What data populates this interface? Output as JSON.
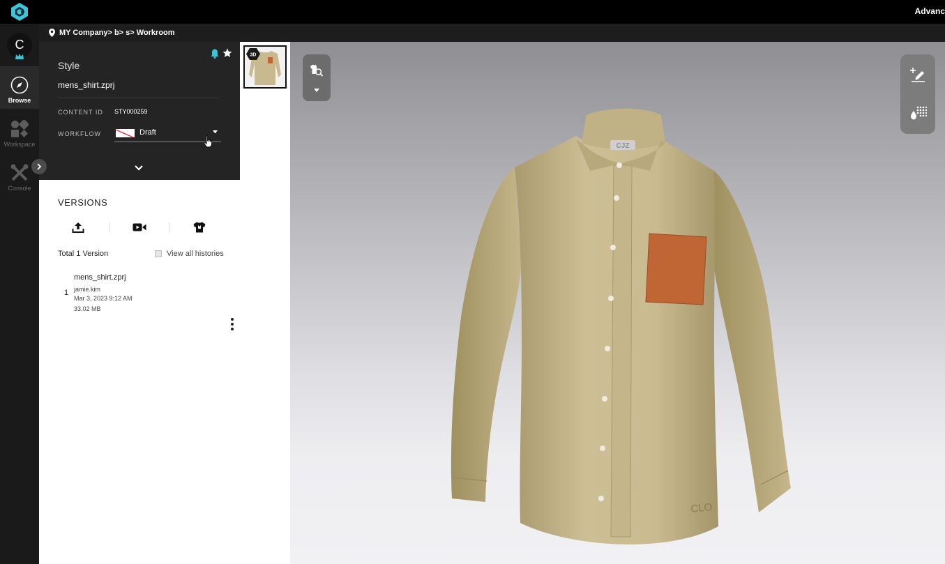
{
  "topbar": {
    "right_text": "Advanc"
  },
  "rail": {
    "avatar_letter": "C",
    "items": [
      {
        "label": "Browse",
        "active": true
      },
      {
        "label": "Workspace",
        "active": false
      },
      {
        "label": "Console",
        "active": false
      }
    ]
  },
  "breadcrumb": {
    "path": "MY Company> b> s> Workroom"
  },
  "style_panel": {
    "title": "Style",
    "file_name": "mens_shirt.zprj",
    "content_id_label": "CONTENT ID",
    "content_id_value": "STY000259",
    "workflow_label": "WORKFLOW",
    "workflow_value": "Draft"
  },
  "versions": {
    "title": "VERSIONS",
    "total": "Total 1 Version",
    "view_all_label": "View all histories",
    "items": [
      {
        "number": "1",
        "name": "mens_shirt.zprj",
        "author": "jamie.kim",
        "date": "Mar 3, 2023 9:12 AM",
        "size": "33.02 MB"
      }
    ]
  },
  "thumbnail": {
    "badge": "3D"
  },
  "viewer": {
    "collar_label": "CJZ",
    "hem_label": "CLO"
  },
  "colors": {
    "accent": "#3fc3d9",
    "shirt": "#c8b98f",
    "pocket": "#bf6634"
  }
}
